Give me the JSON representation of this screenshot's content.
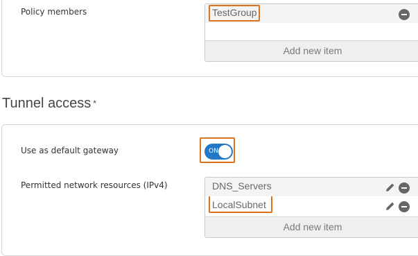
{
  "policy_members": {
    "label": "Policy members",
    "items": [
      "TestGroup"
    ],
    "add_label": "Add new item"
  },
  "tunnel_access": {
    "title": "Tunnel access",
    "required_marker": "*",
    "default_gateway": {
      "label": "Use as default gateway",
      "toggle_text": "ON",
      "enabled": true
    },
    "permitted_resources": {
      "label": "Permitted network resources (IPv4)",
      "items": [
        "DNS_Servers",
        "LocalSubnet"
      ],
      "add_label": "Add new item"
    }
  },
  "colors": {
    "highlight": "#d9731f",
    "toggle_on": "#2378c6"
  },
  "icons": {
    "remove": "minus-circle-icon",
    "edit": "pencil-icon"
  }
}
